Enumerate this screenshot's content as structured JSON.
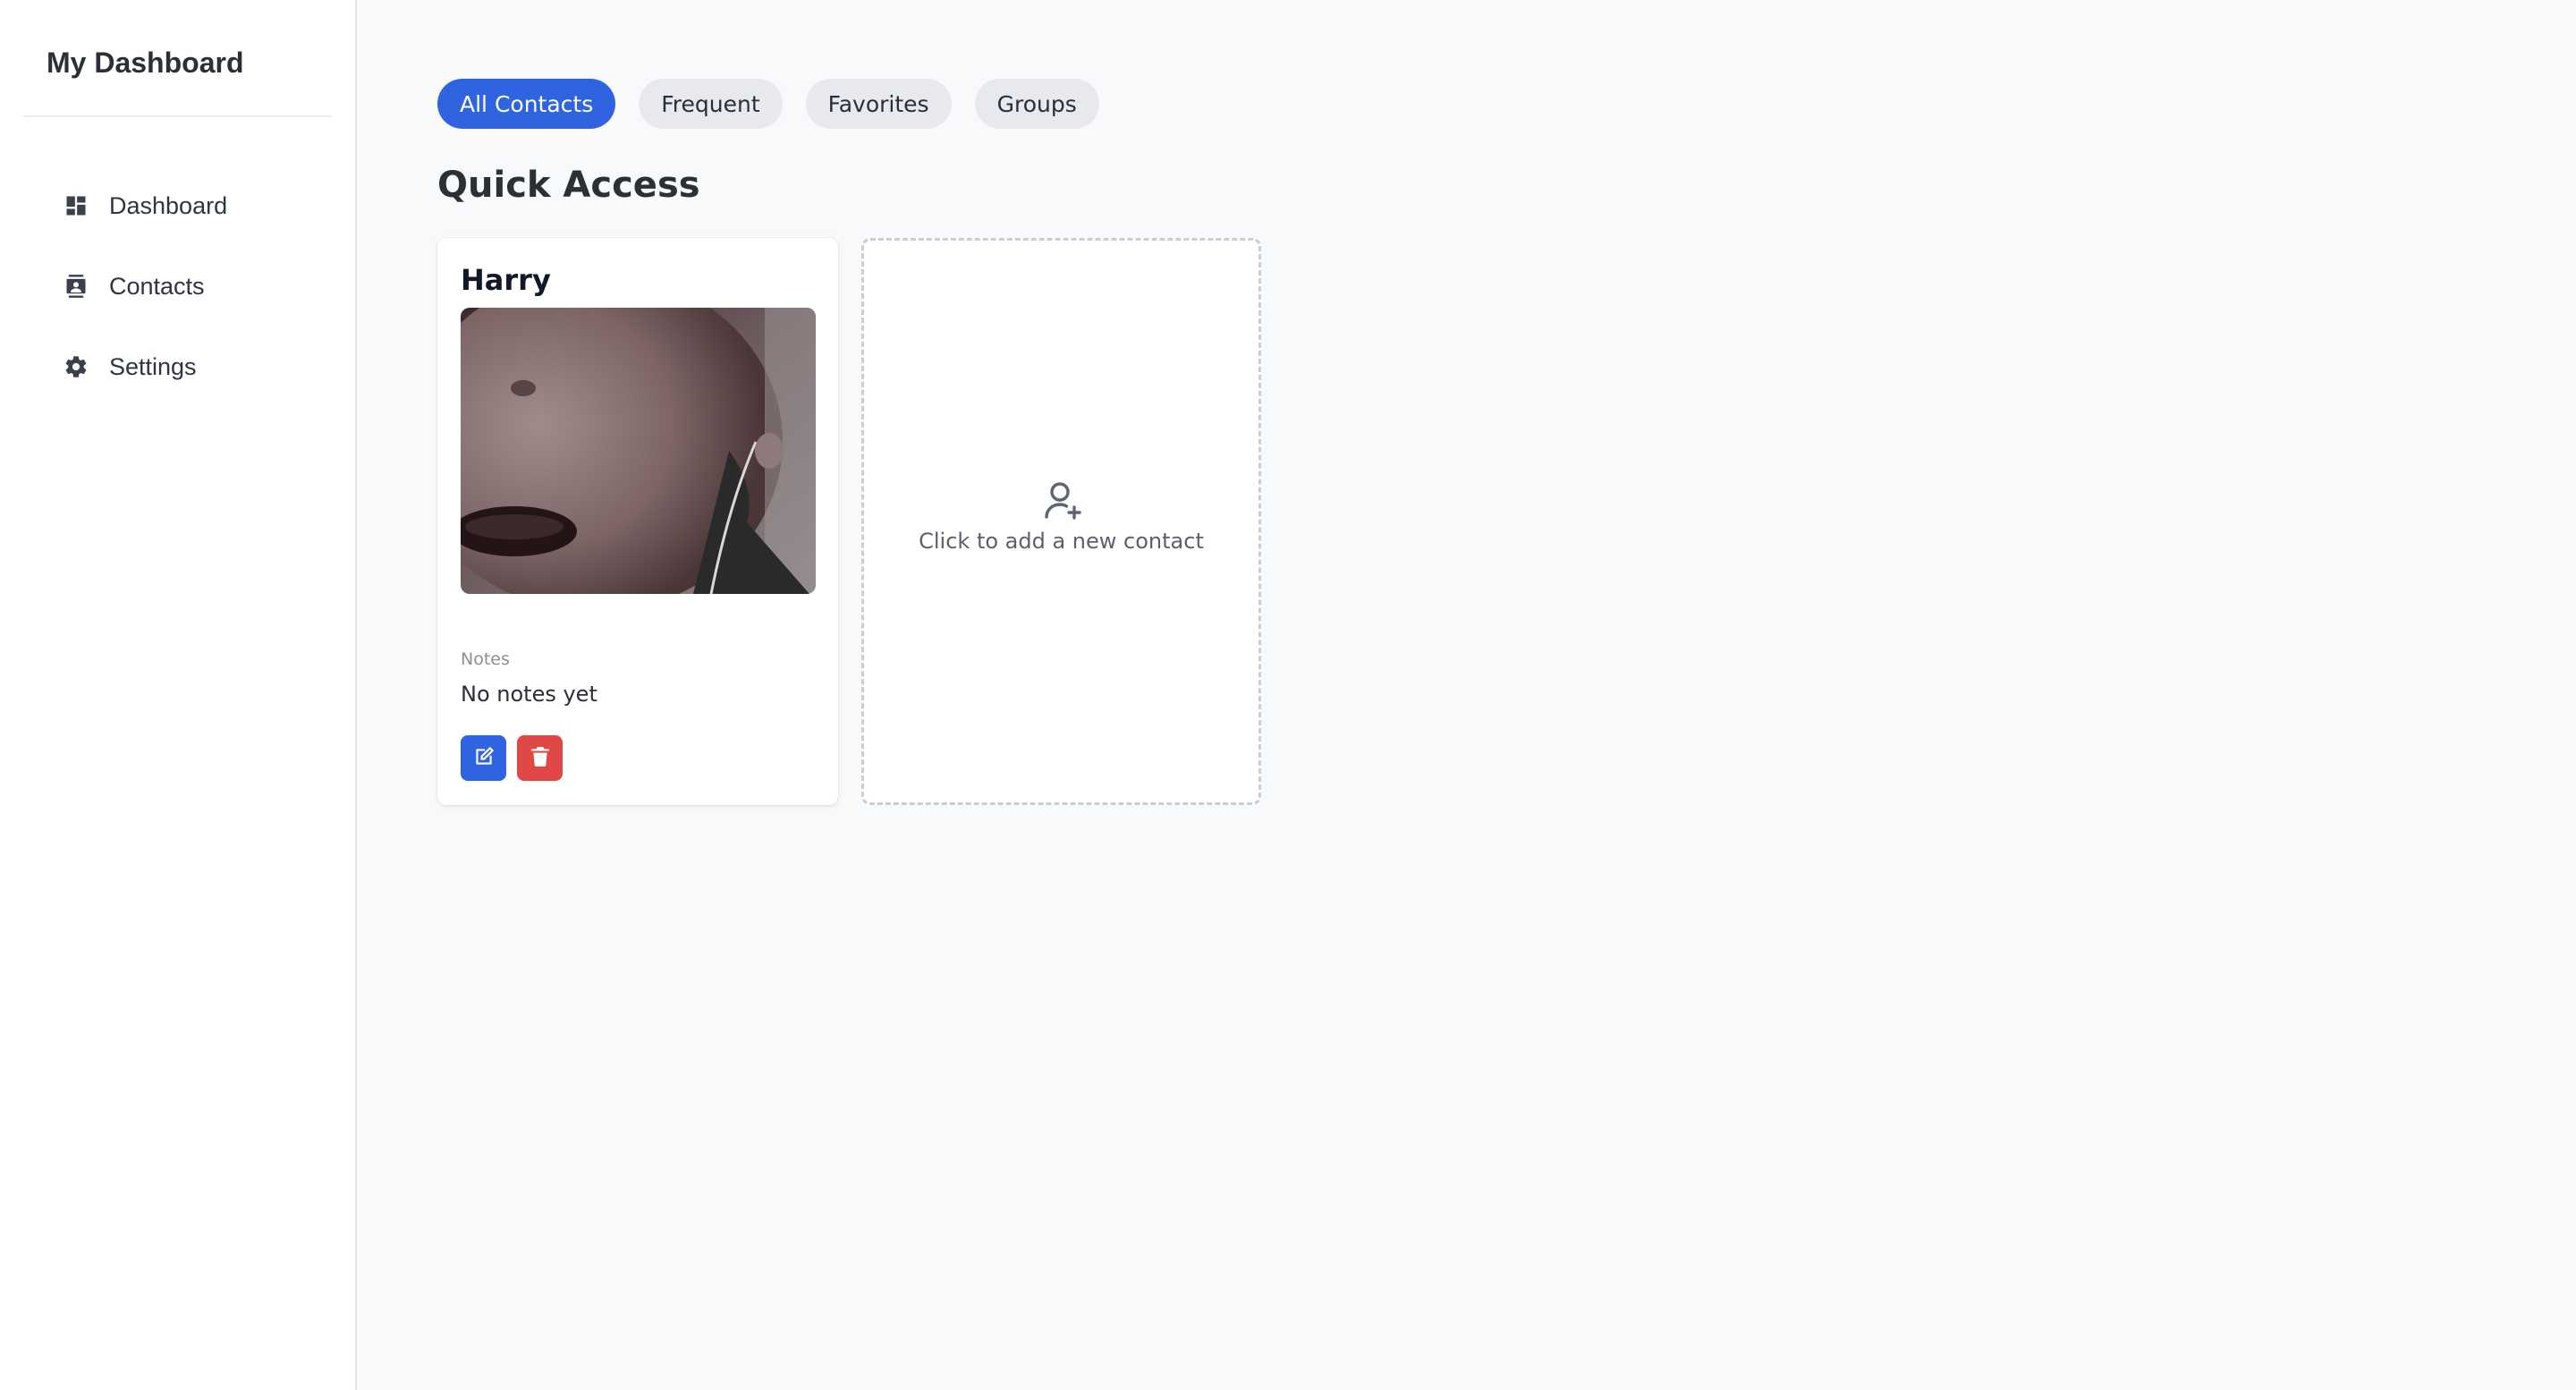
{
  "sidebar": {
    "brand": "My Dashboard",
    "items": [
      {
        "label": "Dashboard",
        "icon": "dashboard-icon"
      },
      {
        "label": "Contacts",
        "icon": "contacts-icon"
      },
      {
        "label": "Settings",
        "icon": "gear-icon"
      }
    ]
  },
  "tabs": [
    {
      "label": "All Contacts",
      "active": true
    },
    {
      "label": "Frequent",
      "active": false
    },
    {
      "label": "Favorites",
      "active": false
    },
    {
      "label": "Groups",
      "active": false
    }
  ],
  "main": {
    "section_title": "Quick Access",
    "contact_card": {
      "name": "Harry",
      "notes_label": "Notes",
      "notes_value": "No notes yet",
      "actions": [
        "edit-icon",
        "trash-icon"
      ]
    },
    "add_card": {
      "text": "Click to add a new contact",
      "icon": "user-plus-icon"
    }
  },
  "colors": {
    "accent": "#2f63e0",
    "danger": "#e04848",
    "background": "#f8f9fb",
    "tab_inactive": "#e7e9ee"
  }
}
